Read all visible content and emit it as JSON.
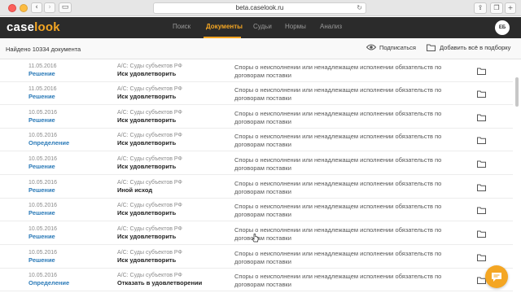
{
  "browser": {
    "url": "beta.caselook.ru",
    "back_glyph": "‹",
    "forward_glyph": "›",
    "sidebar_glyph": "▭",
    "reload_glyph": "↻",
    "share_glyph": "⇪",
    "tabs_glyph": "❐",
    "newtab_glyph": "+"
  },
  "app": {
    "logo_main": "case",
    "logo_accent": "look",
    "nav": [
      {
        "label": "Поиск",
        "active": false
      },
      {
        "label": "Документы",
        "active": true
      },
      {
        "label": "Судьи",
        "active": false
      },
      {
        "label": "Нормы",
        "active": false
      },
      {
        "label": "Анализ",
        "active": false
      }
    ],
    "avatar_initials": "ЕБ",
    "accent_color": "#f4a623",
    "link_color": "#2a7ab8",
    "header_bg": "#2b2b2b"
  },
  "toolbar": {
    "found_text": "Найдено 10334 документа",
    "subscribe_label": "Подписаться",
    "subscribe_icon": "eye-icon",
    "add_all_label": "Добавить всё в подборку",
    "add_all_icon": "folder-icon"
  },
  "documents": [
    {
      "date": "11.05.2016",
      "type": "Решение",
      "court": "А/С: Суды субъектов РФ",
      "result": "Иск удовлетворить",
      "topic": "Споры о неисполнении или ненадлежащем исполнении обязательств по договорам поставки"
    },
    {
      "date": "11.05.2016",
      "type": "Решение",
      "court": "А/С: Суды субъектов РФ",
      "result": "Иск удовлетворить",
      "topic": "Споры о неисполнении или ненадлежащем исполнении обязательств по договорам поставки"
    },
    {
      "date": "10.05.2016",
      "type": "Решение",
      "court": "А/С: Суды субъектов РФ",
      "result": "Иск удовлетворить",
      "topic": "Споры о неисполнении или ненадлежащем исполнении обязательств по договорам поставки"
    },
    {
      "date": "10.05.2016",
      "type": "Определение",
      "court": "А/С: Суды субъектов РФ",
      "result": "Иск удовлетворить",
      "topic": "Споры о неисполнении или ненадлежащем исполнении обязательств по договорам поставки"
    },
    {
      "date": "10.05.2016",
      "type": "Решение",
      "court": "А/С: Суды субъектов РФ",
      "result": "Иск удовлетворить",
      "topic": "Споры о неисполнении или ненадлежащем исполнении обязательств по договорам поставки"
    },
    {
      "date": "10.05.2016",
      "type": "Решение",
      "court": "А/С: Суды субъектов РФ",
      "result": "Иной исход",
      "topic": "Споры о неисполнении или ненадлежащем исполнении обязательств по договорам поставки"
    },
    {
      "date": "10.05.2016",
      "type": "Решение",
      "court": "А/С: Суды субъектов РФ",
      "result": "Иск удовлетворить",
      "topic": "Споры о неисполнении или ненадлежащем исполнении обязательств по договорам поставки"
    },
    {
      "date": "10.05.2016",
      "type": "Решение",
      "court": "А/С: Суды субъектов РФ",
      "result": "Иск удовлетворить",
      "topic": "Споры о неисполнении или ненадлежащем исполнении обязательств по договорам поставки"
    },
    {
      "date": "10.05.2016",
      "type": "Решение",
      "court": "А/С: Суды субъектов РФ",
      "result": "Иск удовлетворить",
      "topic": "Споры о неисполнении или ненадлежащем исполнении обязательств по договорам поставки"
    },
    {
      "date": "10.05.2016",
      "type": "Определение",
      "court": "А/С: Суды субъектов РФ",
      "result": "Отказать в удовлетворении",
      "topic": "Споры о неисполнении или ненадлежащем исполнении обязательств по договорам поставки"
    }
  ],
  "row_icon": "folder-icon",
  "chat_icon": "chat-icon"
}
